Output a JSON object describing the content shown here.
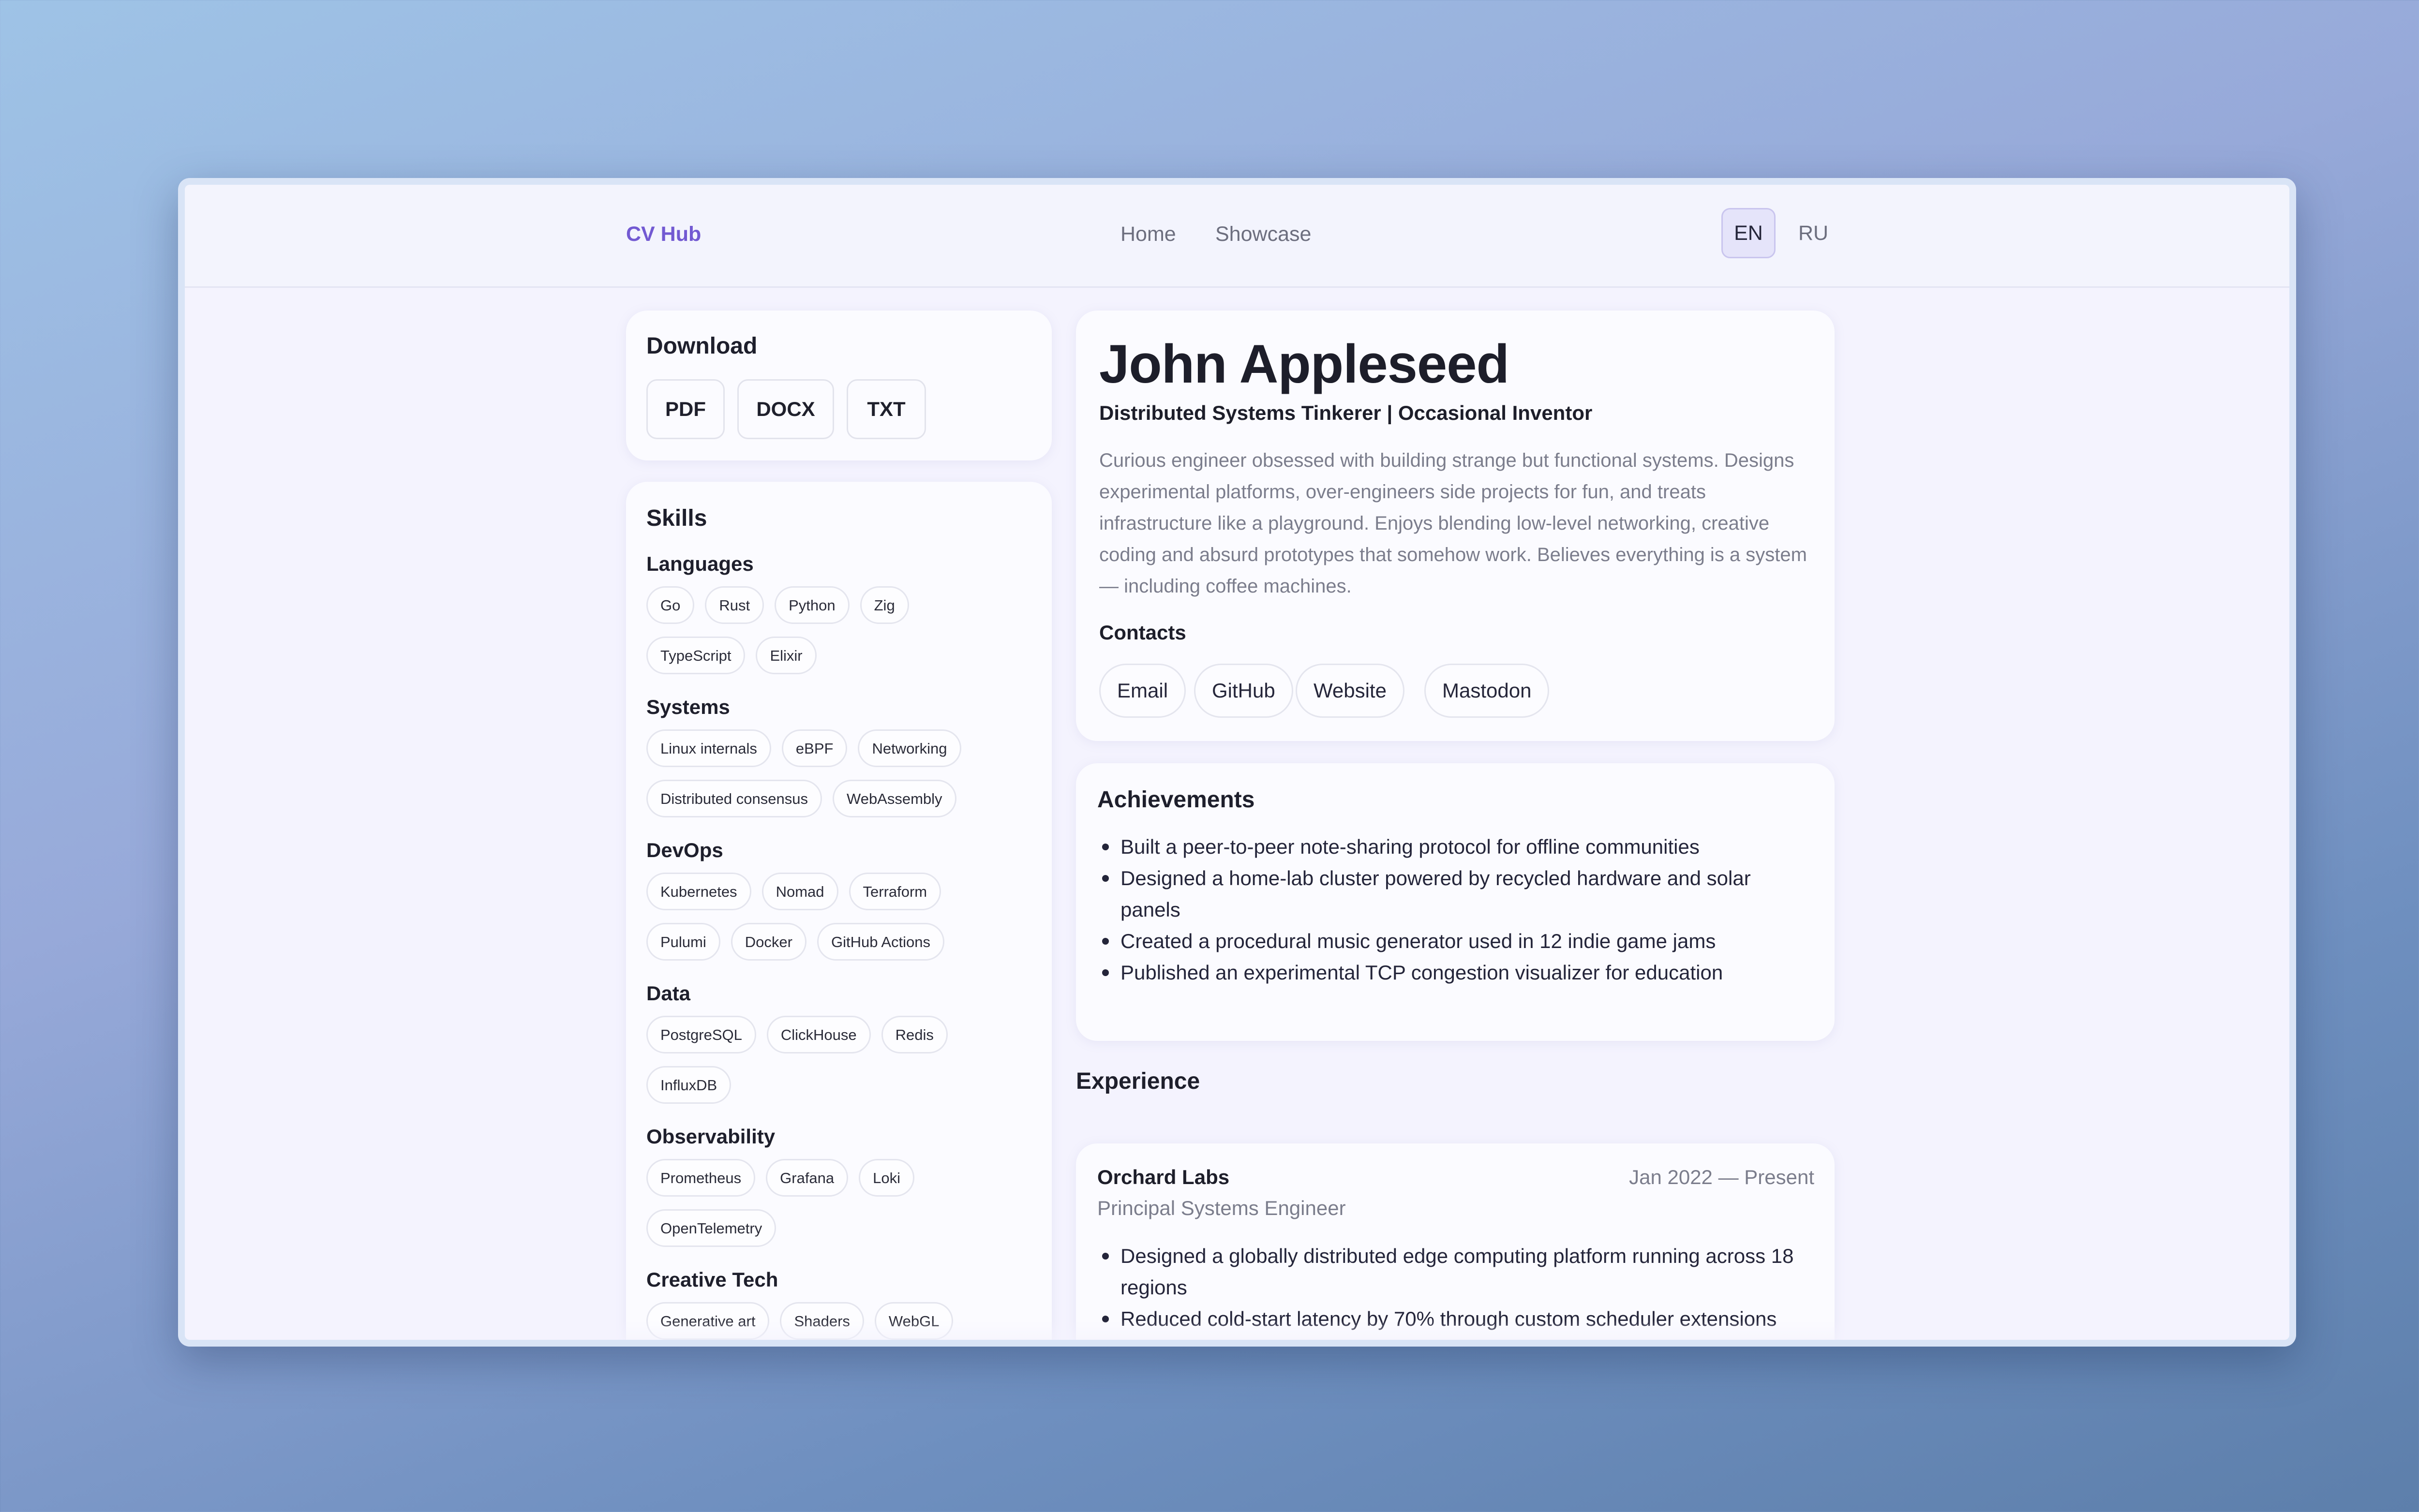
{
  "nav": {
    "logo": "CV Hub",
    "links": [
      "Home",
      "Showcase"
    ],
    "languages": [
      {
        "code": "EN",
        "active": true
      },
      {
        "code": "RU",
        "active": false
      }
    ]
  },
  "download": {
    "title": "Download",
    "formats": [
      "PDF",
      "DOCX",
      "TXT"
    ]
  },
  "skills": {
    "title": "Skills",
    "groups": [
      {
        "name": "Languages",
        "rows": [
          [
            "Go",
            "Rust",
            "Python",
            "Zig"
          ],
          [
            "TypeScript",
            "Elixir"
          ]
        ]
      },
      {
        "name": "Systems",
        "rows": [
          [
            "Linux internals",
            "eBPF",
            "Networking"
          ],
          [
            "Distributed consensus",
            "WebAssembly"
          ]
        ]
      },
      {
        "name": "DevOps",
        "rows": [
          [
            "Kubernetes",
            "Nomad",
            "Terraform"
          ],
          [
            "Pulumi",
            "Docker",
            "GitHub Actions"
          ]
        ]
      },
      {
        "name": "Data",
        "rows": [
          [
            "PostgreSQL",
            "ClickHouse",
            "Redis"
          ],
          [
            "InfluxDB"
          ]
        ]
      },
      {
        "name": "Observability",
        "rows": [
          [
            "Prometheus",
            "Grafana",
            "Loki"
          ],
          [
            "OpenTelemetry"
          ]
        ]
      },
      {
        "name": "Creative Tech",
        "rows": [
          [
            "Generative art",
            "Shaders",
            "WebGL"
          ]
        ]
      }
    ]
  },
  "profile": {
    "name": "John Appleseed",
    "headline": "Distributed Systems Tinkerer | Occasional Inventor",
    "summary": "Curious engineer obsessed with building strange but functional systems. Designs experimental platforms, over-engineers side projects for fun, and treats infrastructure like a playground. Enjoys blending low-level networking, creative coding and absurd prototypes that somehow work. Believes everything is a system — including coffee machines.",
    "contacts_title": "Contacts",
    "contacts": [
      "Email",
      "GitHub",
      "Website",
      "Mastodon"
    ]
  },
  "achievements": {
    "title": "Achievements",
    "items": [
      "Built a peer-to-peer note-sharing protocol for offline communities",
      "Designed a home-lab cluster powered by recycled hardware and solar panels",
      "Created a procedural music generator used in 12 indie game jams",
      "Published an experimental TCP congestion visualizer for education"
    ]
  },
  "experience": {
    "title": "Experience",
    "jobs": [
      {
        "company": "Orchard Labs",
        "dates": "Jan 2022 — Present",
        "role": "Principal Systems Engineer",
        "bullets": [
          "Designed a globally distributed edge computing platform running across 18 regions",
          "Reduced cold-start latency by 70% through custom scheduler extensions"
        ]
      }
    ]
  }
}
